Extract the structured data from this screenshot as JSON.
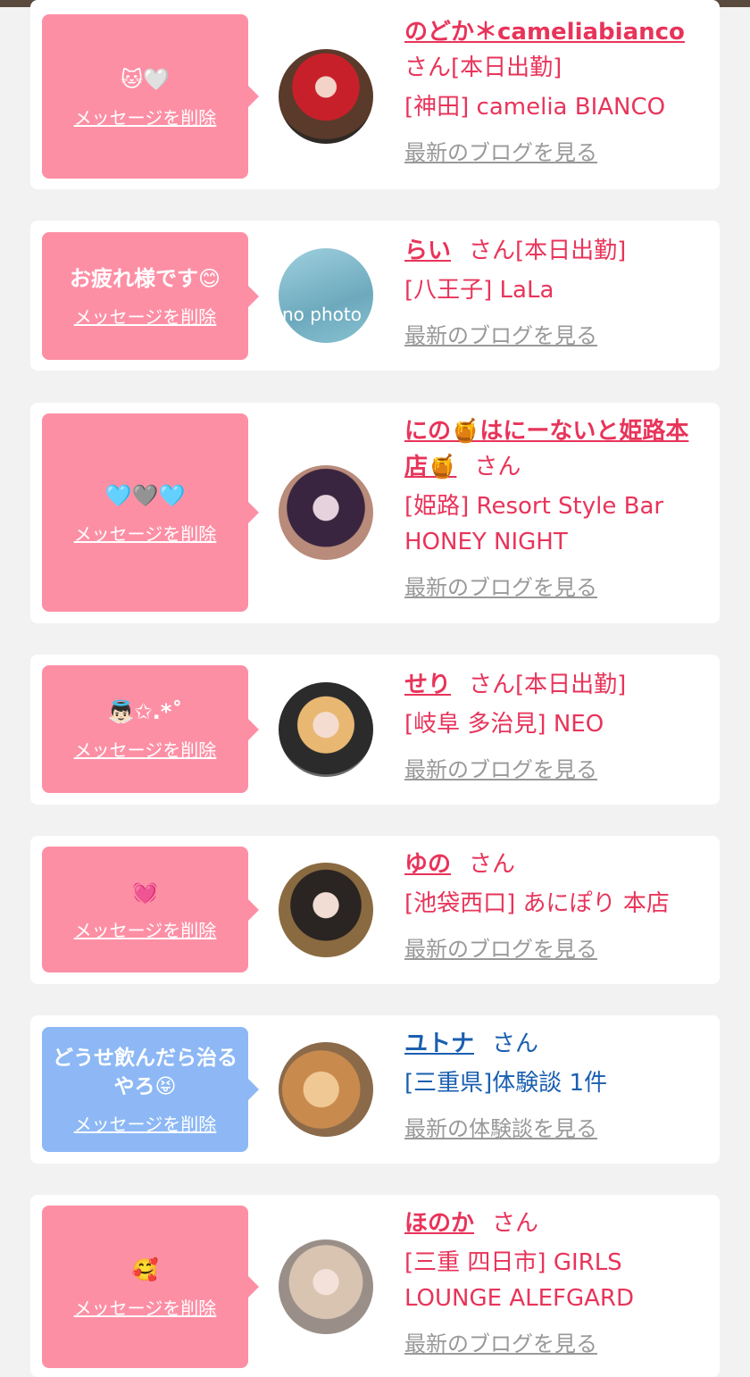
{
  "delete_label": "メッセージを削除",
  "colors": {
    "pink_bubble": "#fd8fa5",
    "blue_bubble": "#8db8f5",
    "name_pink": "#e8345a",
    "name_blue": "#1a5fb0"
  },
  "items": [
    {
      "message": "🐱🤍",
      "name": "のどか＊cameliabianco",
      "san": "さん[本日出勤]",
      "shop": "[神田] camelia BIANCO",
      "link": "最新のブログを見る",
      "avatar_icon": "girl-photo-red"
    },
    {
      "message": "お疲れ様です😊",
      "name": "らい",
      "san": "さん[本日出勤]",
      "shop": "[八王子] LaLa",
      "link": "最新のブログを見る",
      "avatar_icon": "no-photo",
      "avatar_text": "no photo"
    },
    {
      "message": "🩵🩶🩵",
      "name": "にの🍯はにーないと姫路本店🍯",
      "san": "さん",
      "shop": "[姫路] Resort Style Bar HONEY NIGHT",
      "link": "最新のブログを見る",
      "avatar_icon": "girl-photo-dark"
    },
    {
      "message": "👼🏻✩.*˚",
      "name": "せり",
      "san": "さん[本日出勤]",
      "shop": "[岐阜 多治見] NEO",
      "link": "最新のブログを見る",
      "avatar_icon": "girl-photo-maid"
    },
    {
      "message": "💓",
      "name": "ゆの",
      "san": "さん",
      "shop": "[池袋西口] あにぽり 本店",
      "link": "最新のブログを見る",
      "avatar_icon": "girl-photo-maid2"
    },
    {
      "message": "どうせ飲んだら治るやろ😝",
      "name": "ユトナ",
      "san": "さん",
      "shop": "[三重県]体験談 1件",
      "link": "最新の体験談を見る",
      "avatar_icon": "hamster-photo"
    },
    {
      "message": "🥰",
      "name": "ほのか",
      "san": "さん",
      "shop": "[三重 四日市] GIRLS LOUNGE ALEFGARD",
      "link": "最新のブログを見る",
      "avatar_icon": "girl-photo-blonde"
    }
  ]
}
